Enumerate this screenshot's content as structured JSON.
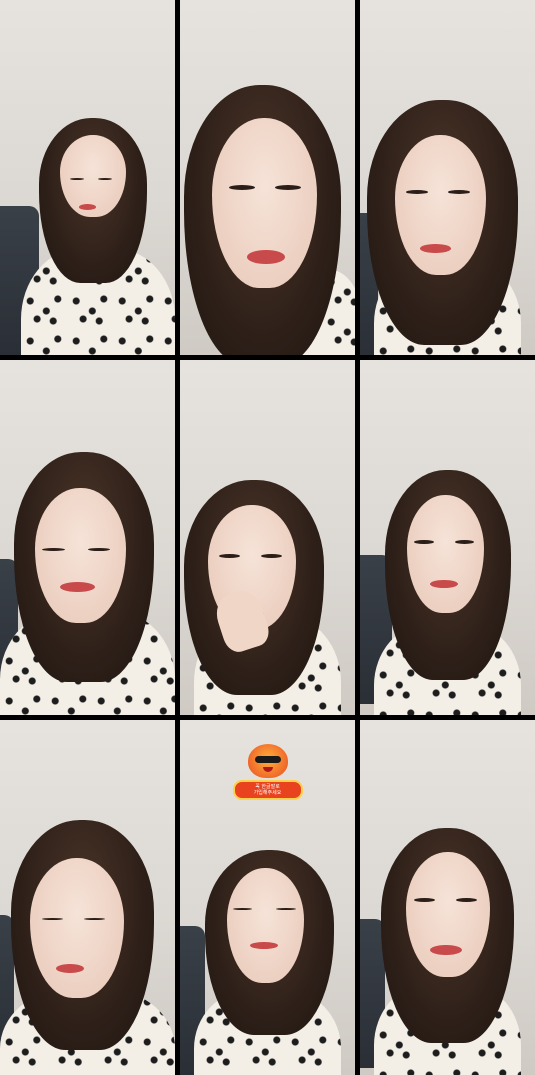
{
  "layout": {
    "columns": 3,
    "rows": 3
  },
  "colors": {
    "divider": "#000000",
    "wall": "#e3e0db",
    "hair": "#2e2019",
    "blouse": "#f4efe6",
    "lips": "#c84a4a",
    "sticker_orange": "#e8421f"
  },
  "tiles": [
    {
      "id": "r1c1",
      "pose": "looking-down-left",
      "has_sticker": false
    },
    {
      "id": "r1c2",
      "pose": "close-up-front",
      "has_sticker": false
    },
    {
      "id": "r1c3",
      "pose": "front",
      "has_sticker": false
    },
    {
      "id": "r2c1",
      "pose": "smiling-down",
      "has_sticker": false
    },
    {
      "id": "r2c2",
      "pose": "hand-on-chin",
      "has_sticker": false
    },
    {
      "id": "r2c3",
      "pose": "smiling-front",
      "has_sticker": false
    },
    {
      "id": "r3c1",
      "pose": "eyes-closed",
      "has_sticker": false
    },
    {
      "id": "r3c2",
      "pose": "eyes-down",
      "has_sticker": true
    },
    {
      "id": "r3c3",
      "pose": "talking-front",
      "has_sticker": false
    }
  ],
  "sticker": {
    "icon": "mascot-sunglasses-icon",
    "line1": "꼭 한글말로",
    "line2": "가입해주세요"
  }
}
